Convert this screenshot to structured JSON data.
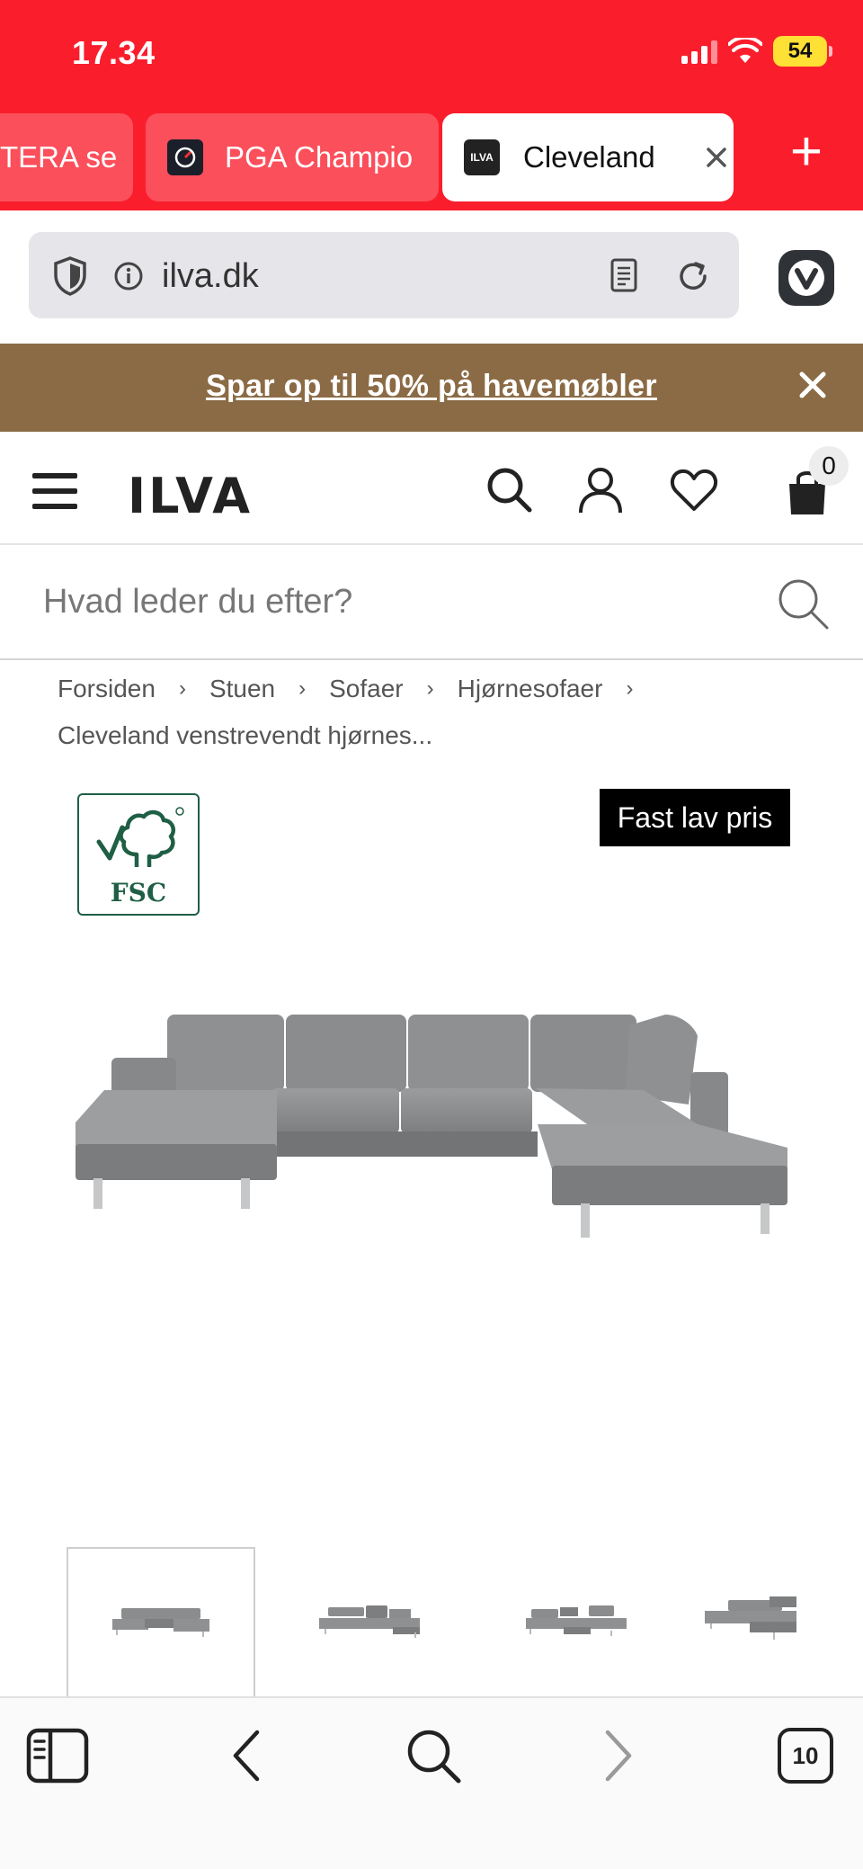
{
  "status_bar": {
    "time": "17.34",
    "battery": "54"
  },
  "tabs": [
    {
      "label": "TERA se",
      "active": false
    },
    {
      "label": "PGA Champio",
      "active": false
    },
    {
      "label": "Cleveland",
      "active": true,
      "favicon_text": "ILVA"
    }
  ],
  "address_bar": {
    "url": "ilva.dk"
  },
  "promo": {
    "text": "Spar op til 50% på havemøbler"
  },
  "header": {
    "logo": "ILVA",
    "cart_count": "0"
  },
  "search": {
    "placeholder": "Hvad leder du efter?"
  },
  "breadcrumbs": {
    "items": [
      "Forsiden",
      "Stuen",
      "Sofaer",
      "Hjørnesofaer"
    ],
    "current": "Cleveland venstrevendt hjørnes..."
  },
  "product": {
    "certification": "FSC",
    "badge": "Fast lav pris",
    "sofa_color": "#8a8c8e"
  },
  "toolbar": {
    "tab_count": "10"
  },
  "colors": {
    "browser_accent": "#fa1e2d",
    "promo_bg": "#8b6b45",
    "fsc_green": "#1f5f45"
  }
}
